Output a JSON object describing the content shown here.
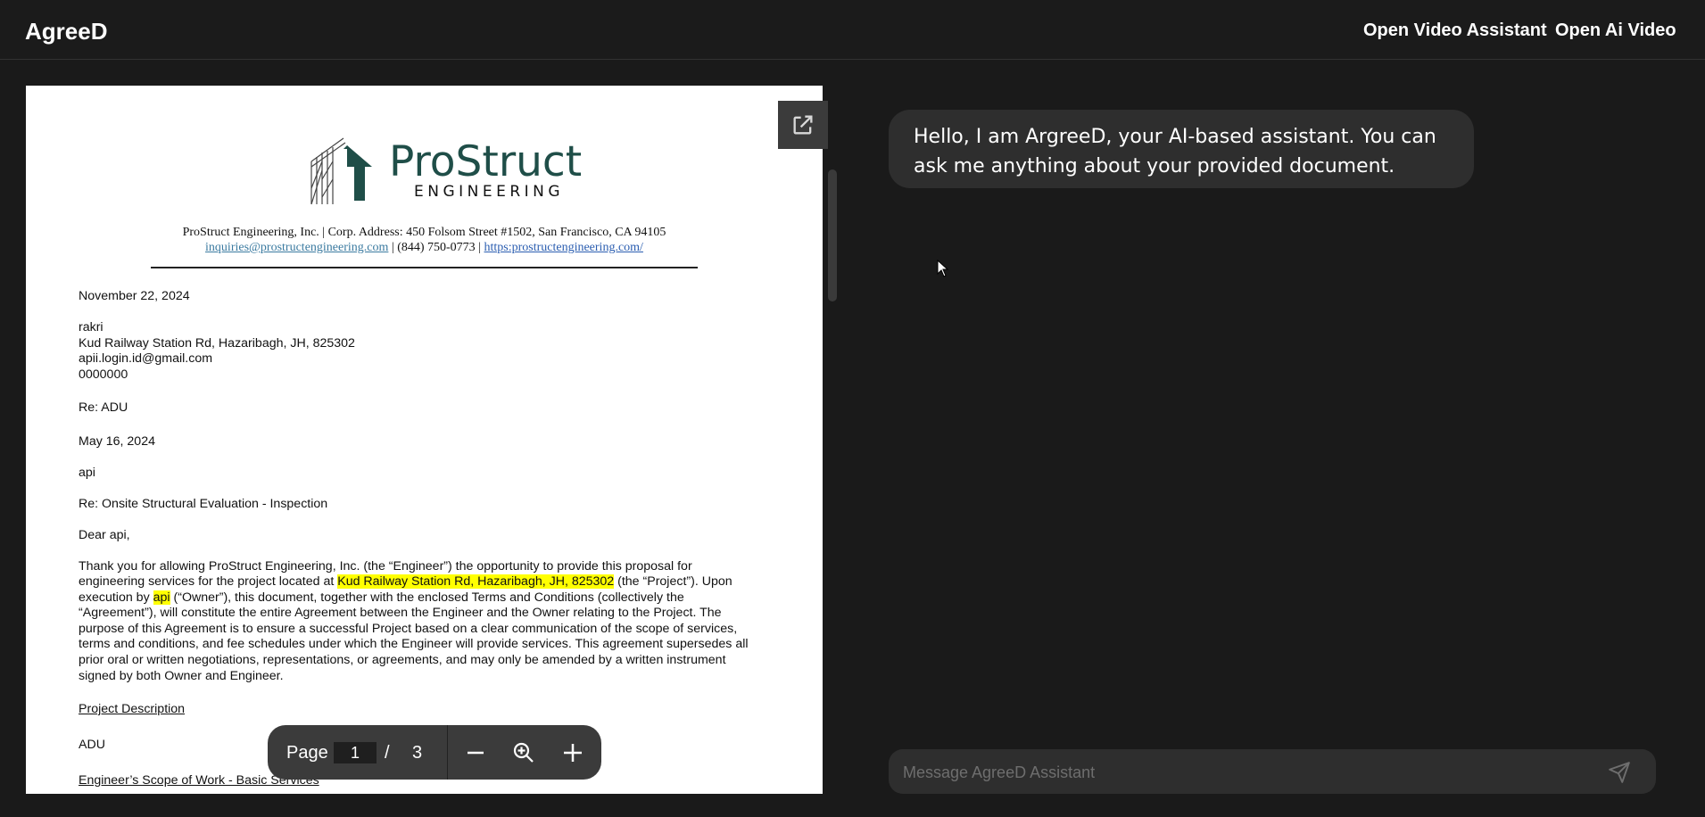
{
  "app": {
    "brand": "AgreeD",
    "nav": [
      "Open Video Assistant",
      "Open Ai Video"
    ]
  },
  "colors": {
    "background": "#1a1a1a",
    "panel": "#3b3b3b",
    "bubble": "#2e2e2e",
    "logo": "#1f4e48",
    "highlight": "#ffff00"
  },
  "document": {
    "logo_name": "ProStruct",
    "logo_sub": "ENGINEERING",
    "letterhead_line1": "ProStruct Engineering, Inc. | Corp. Address: 450 Folsom Street #1502, San Francisco, CA 94105",
    "letterhead_email": "inquiries@prostructengineering.com",
    "letterhead_sep1": " | (844) 750-0773 | ",
    "letterhead_url": "https:prostructengineering.com/",
    "date": "November 22, 2024",
    "recipient_name": "rakri",
    "recipient_address": "Kud Railway Station Rd, Hazaribagh, JH, 825302",
    "recipient_email": "apii.login.id@gmail.com",
    "recipient_phone": "0000000",
    "re_project": "Re: ADU",
    "date2": "May 16, 2024",
    "client": "api",
    "re_subject": "Re: Onsite Structural Evaluation - Inspection",
    "salutation": "Dear api,",
    "body_l1": "Thank you for allowing ProStruct Engineering, Inc. (the “Engineer”) the opportunity to provide this proposal for",
    "body_l2a": "engineering services for the project located at ",
    "body_l2_hl": "Kud Railway Station Rd, Hazaribagh, JH, 825302",
    "body_l2b": " (the “Project”).  Upon",
    "body_l3a": "execution by ",
    "body_l3_hl": "api",
    "body_l3b": " (“Owner”), this document, together with the enclosed Terms and Conditions (collectively the",
    "body_l4": "“Agreement”), will constitute the entire Agreement between the Engineer and the Owner relating to the Project.  The",
    "body_l5": "purpose of this Agreement is to ensure a successful Project based on a clear communication of the scope of services,",
    "body_l6": "terms and conditions, and fee schedules under which the Engineer will provide services. This agreement supersedes all",
    "body_l7": "prior oral or written negotiations, representations, or agreements, and may only be amended by a written instrument",
    "body_l8": "signed by both Owner and Engineer.",
    "section1": "Project Description",
    "project_type": "ADU",
    "section2": "Engineer’s Scope of Work - Basic Services"
  },
  "pager": {
    "label": "Page",
    "current": "1",
    "separator": "/",
    "total": "3",
    "zoom_out_icon": "minus-icon",
    "zoom_reset_icon": "magnifier-plus-icon",
    "zoom_in_icon": "plus-icon"
  },
  "chat": {
    "greeting": "Hello, I am ArgreeD, your AI-based assistant. You can ask me anything about your provided document.",
    "placeholder": "Message AgreeD Assistant",
    "send_icon": "send-icon"
  }
}
